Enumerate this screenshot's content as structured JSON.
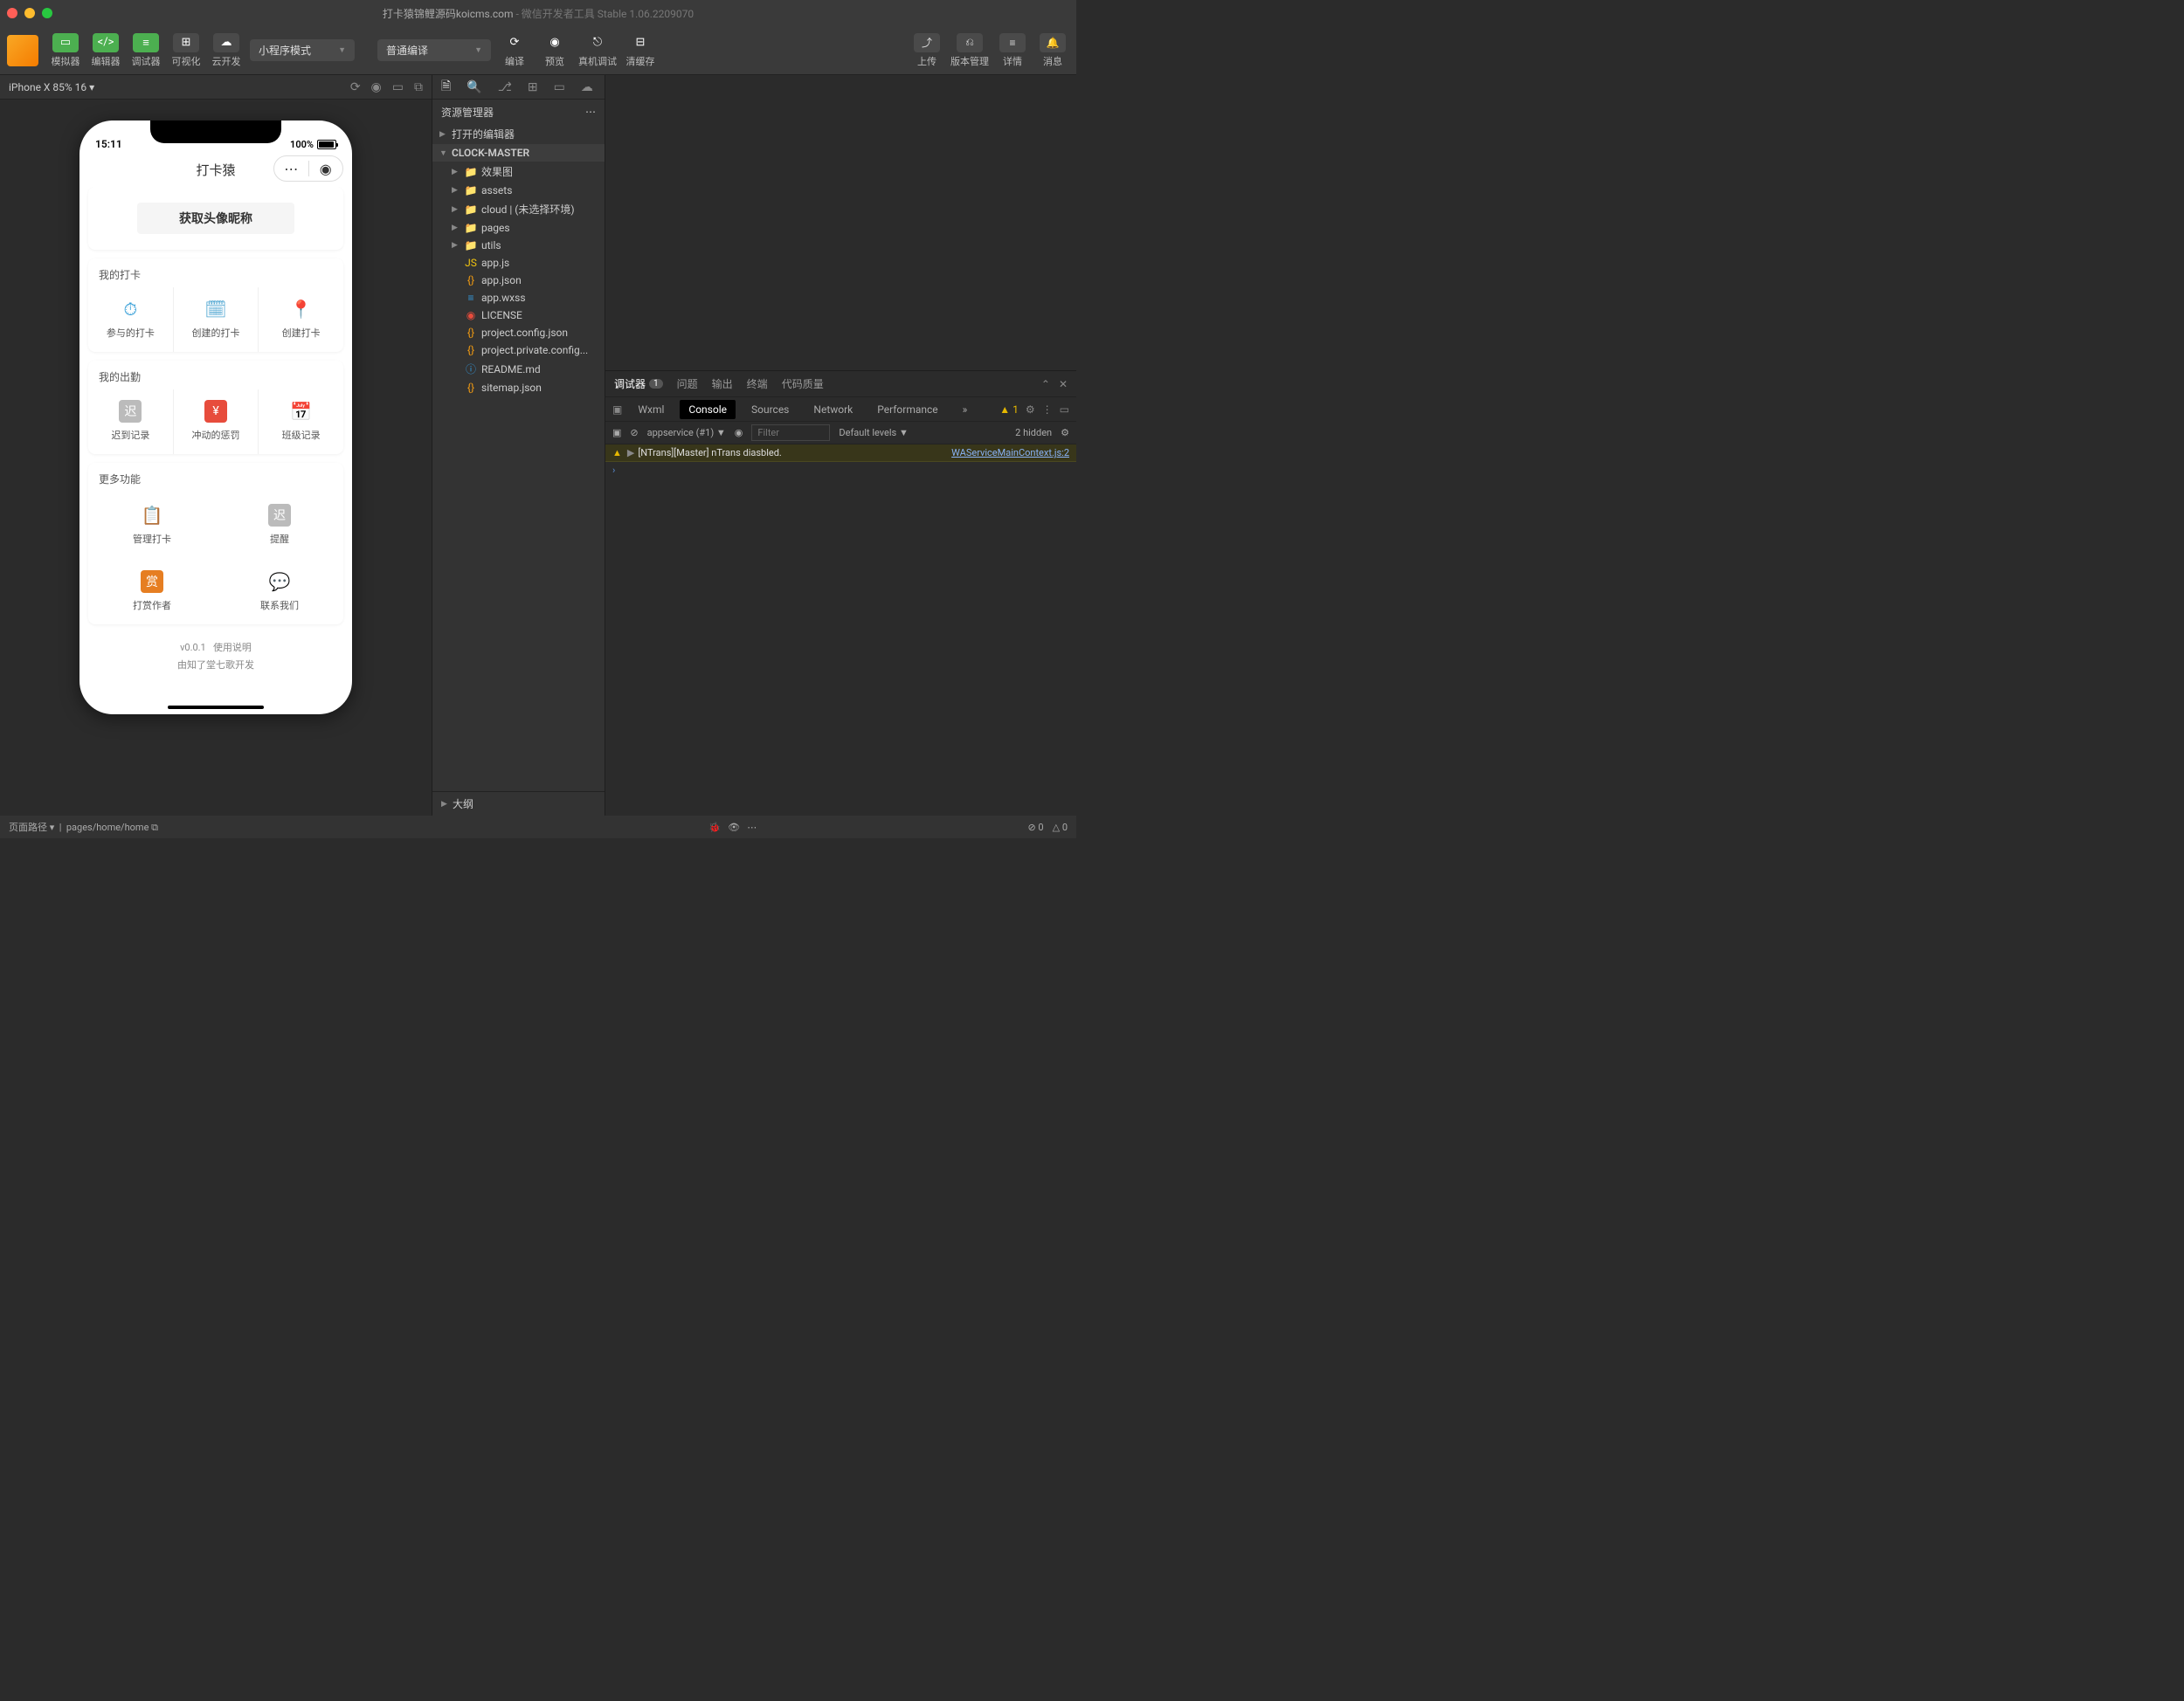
{
  "titlebar": {
    "title": "打卡猿锦鲤源码koicms.com",
    "sub": " - 微信开发者工具 Stable 1.06.2209070"
  },
  "toolbar": {
    "simulator": "模拟器",
    "editor": "编辑器",
    "debugger": "调试器",
    "visualize": "可视化",
    "cloud": "云开发",
    "mode": "小程序模式",
    "compile": "普通编译",
    "compileBtn": "编译",
    "preview": "预览",
    "realDebug": "真机调试",
    "clearCache": "清缓存",
    "upload": "上传",
    "version": "版本管理",
    "detail": "详情",
    "message": "消息"
  },
  "sim": {
    "device": "iPhone X 85% 16",
    "time": "15:11",
    "battery": "100%"
  },
  "app": {
    "navTitle": "打卡猿",
    "getAvatar": "获取头像昵称",
    "sec1Title": "我的打卡",
    "sec1": [
      {
        "label": "参与的打卡",
        "icon": "⏱",
        "color": "#2e9bd6"
      },
      {
        "label": "创建的打卡",
        "icon": "🗓",
        "color": "#4aa3d0"
      },
      {
        "label": "创建打卡",
        "icon": "📍",
        "color": "#e67e22"
      }
    ],
    "sec2Title": "我的出勤",
    "sec2": [
      {
        "label": "迟到记录",
        "icon": "迟",
        "color": "#bbb"
      },
      {
        "label": "冲动的惩罚",
        "icon": "¥",
        "color": "#e74c3c"
      },
      {
        "label": "班级记录",
        "icon": "📅",
        "color": "#27ae60"
      }
    ],
    "sec3Title": "更多功能",
    "sec3": [
      {
        "label": "管理打卡",
        "icon": "📋",
        "color": "#27ae60"
      },
      {
        "label": "提醒",
        "icon": "迟",
        "color": "#bbb"
      },
      {
        "label": "打赏作者",
        "icon": "赏",
        "color": "#e67e22"
      },
      {
        "label": "联系我们",
        "icon": "💬",
        "color": "#e67e22"
      }
    ],
    "footer1a": "v0.0.1",
    "footer1b": "使用说明",
    "footer2": "由知了堂七歌开发"
  },
  "explorer": {
    "title": "资源管理器",
    "openEditors": "打开的编辑器",
    "project": "CLOCK-MASTER",
    "tree": [
      {
        "name": "效果图",
        "type": "folder",
        "cls": "folder-y",
        "depth": 1
      },
      {
        "name": "assets",
        "type": "folder",
        "cls": "folder-y",
        "depth": 1
      },
      {
        "name": "cloud | (未选择环境)",
        "type": "folder",
        "cls": "folder-o",
        "depth": 1
      },
      {
        "name": "pages",
        "type": "folder",
        "cls": "folder-g",
        "depth": 1
      },
      {
        "name": "utils",
        "type": "folder",
        "cls": "folder-g",
        "depth": 1
      },
      {
        "name": "app.js",
        "type": "file",
        "cls": "file-js",
        "icon": "JS",
        "depth": 1
      },
      {
        "name": "app.json",
        "type": "file",
        "cls": "file-json",
        "icon": "{}",
        "depth": 1
      },
      {
        "name": "app.wxss",
        "type": "file",
        "cls": "file-css",
        "icon": "≡",
        "depth": 1
      },
      {
        "name": "LICENSE",
        "type": "file",
        "cls": "file-lic",
        "icon": "◉",
        "depth": 1
      },
      {
        "name": "project.config.json",
        "type": "file",
        "cls": "file-json",
        "icon": "{}",
        "depth": 1
      },
      {
        "name": "project.private.config...",
        "type": "file",
        "cls": "file-json",
        "icon": "{}",
        "depth": 1
      },
      {
        "name": "README.md",
        "type": "file",
        "cls": "file-md",
        "icon": "ⓘ",
        "depth": 1
      },
      {
        "name": "sitemap.json",
        "type": "file",
        "cls": "file-json",
        "icon": "{}",
        "depth": 1
      }
    ],
    "outline": "大纲"
  },
  "debugger": {
    "tabs": {
      "debugger": "调试器",
      "badge": "1",
      "problems": "问题",
      "output": "输出",
      "terminal": "终端",
      "quality": "代码质量"
    },
    "subtabs": {
      "wxml": "Wxml",
      "console": "Console",
      "sources": "Sources",
      "network": "Network",
      "performance": "Performance",
      "warnCount": "1"
    },
    "filter": {
      "context": "appservice (#1)",
      "placeholder": "Filter",
      "levels": "Default levels",
      "hidden": "2 hidden"
    },
    "log": {
      "msg": "[NTrans][Master] nTrans diasbled.",
      "src": "WAServiceMainContext.js:2"
    }
  },
  "statusbar": {
    "pathLabel": "页面路径",
    "path": "pages/home/home",
    "err": "0",
    "warn": "0"
  }
}
